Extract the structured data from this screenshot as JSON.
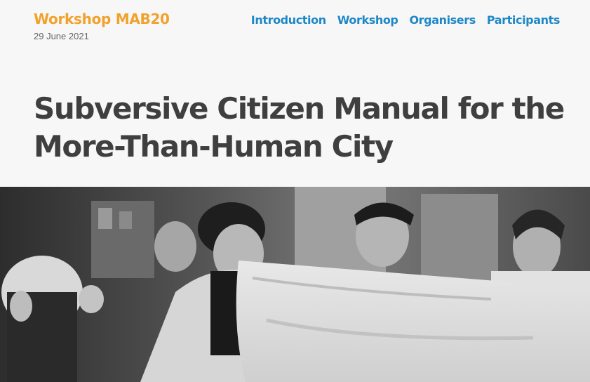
{
  "header": {
    "site_title": "Workshop MAB20",
    "date": "29 June 2021"
  },
  "nav": {
    "items": [
      {
        "label": "Introduction"
      },
      {
        "label": "Workshop"
      },
      {
        "label": "Organisers"
      },
      {
        "label": "Participants"
      }
    ]
  },
  "main": {
    "title": "Subversive Citizen Manual for the More-Than-Human City"
  },
  "colors": {
    "brand": "#f0a22c",
    "nav_link": "#1e88c7",
    "title_text": "#3f3f3f",
    "background": "#f7f7f7"
  }
}
